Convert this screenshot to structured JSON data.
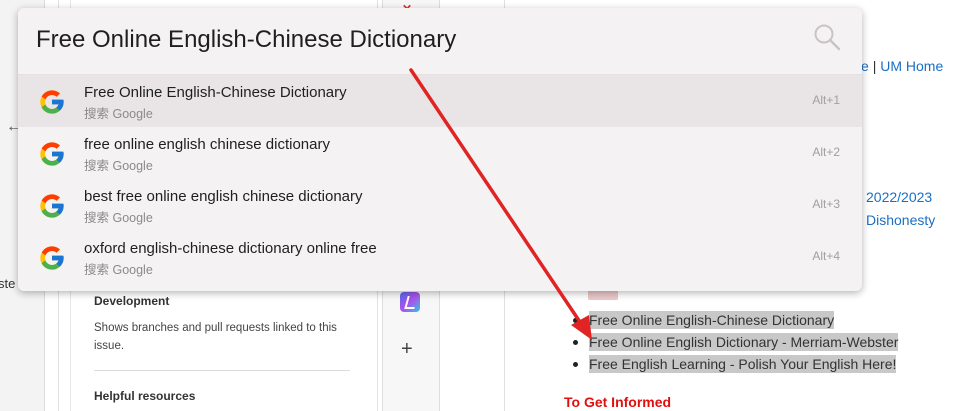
{
  "omnibox": {
    "query": "Free Online English-Chinese Dictionary",
    "suggestions": [
      {
        "text": "Free Online English-Chinese Dictionary",
        "source": "搜索 Google",
        "shortcut": "Alt+1",
        "active": true
      },
      {
        "text": "free online english chinese dictionary",
        "source": "搜索 Google",
        "shortcut": "Alt+2",
        "active": false
      },
      {
        "text": "best free online english chinese dictionary",
        "source": "搜索 Google",
        "shortcut": "Alt+3",
        "active": false
      },
      {
        "text": "oxford english-chinese dictionary online free",
        "source": "搜索 Google",
        "shortcut": "Alt+4",
        "active": false
      }
    ]
  },
  "left_sidebar": {
    "partial_text": "ste"
  },
  "issue_panel": {
    "development_title": "Development",
    "development_text": "Shows branches and pull requests linked to this issue.",
    "helpful_resources_title": "Helpful resources"
  },
  "page": {
    "top_links": {
      "partial": "e",
      "separator": "|",
      "um_home": "UM Home"
    },
    "year_link": "2022/2023",
    "dishonesty_link": "Dishonesty",
    "results": [
      "Free Online English-Chinese Dictionary",
      "Free Online English Dictionary - Merriam-Webster",
      "Free English Learning - Polish Your English Here!"
    ],
    "informed_heading": "To Get Informed"
  },
  "colors": {
    "link": "#1a6fc4",
    "arrow": "#e02424",
    "heading_red": "#e01010"
  }
}
